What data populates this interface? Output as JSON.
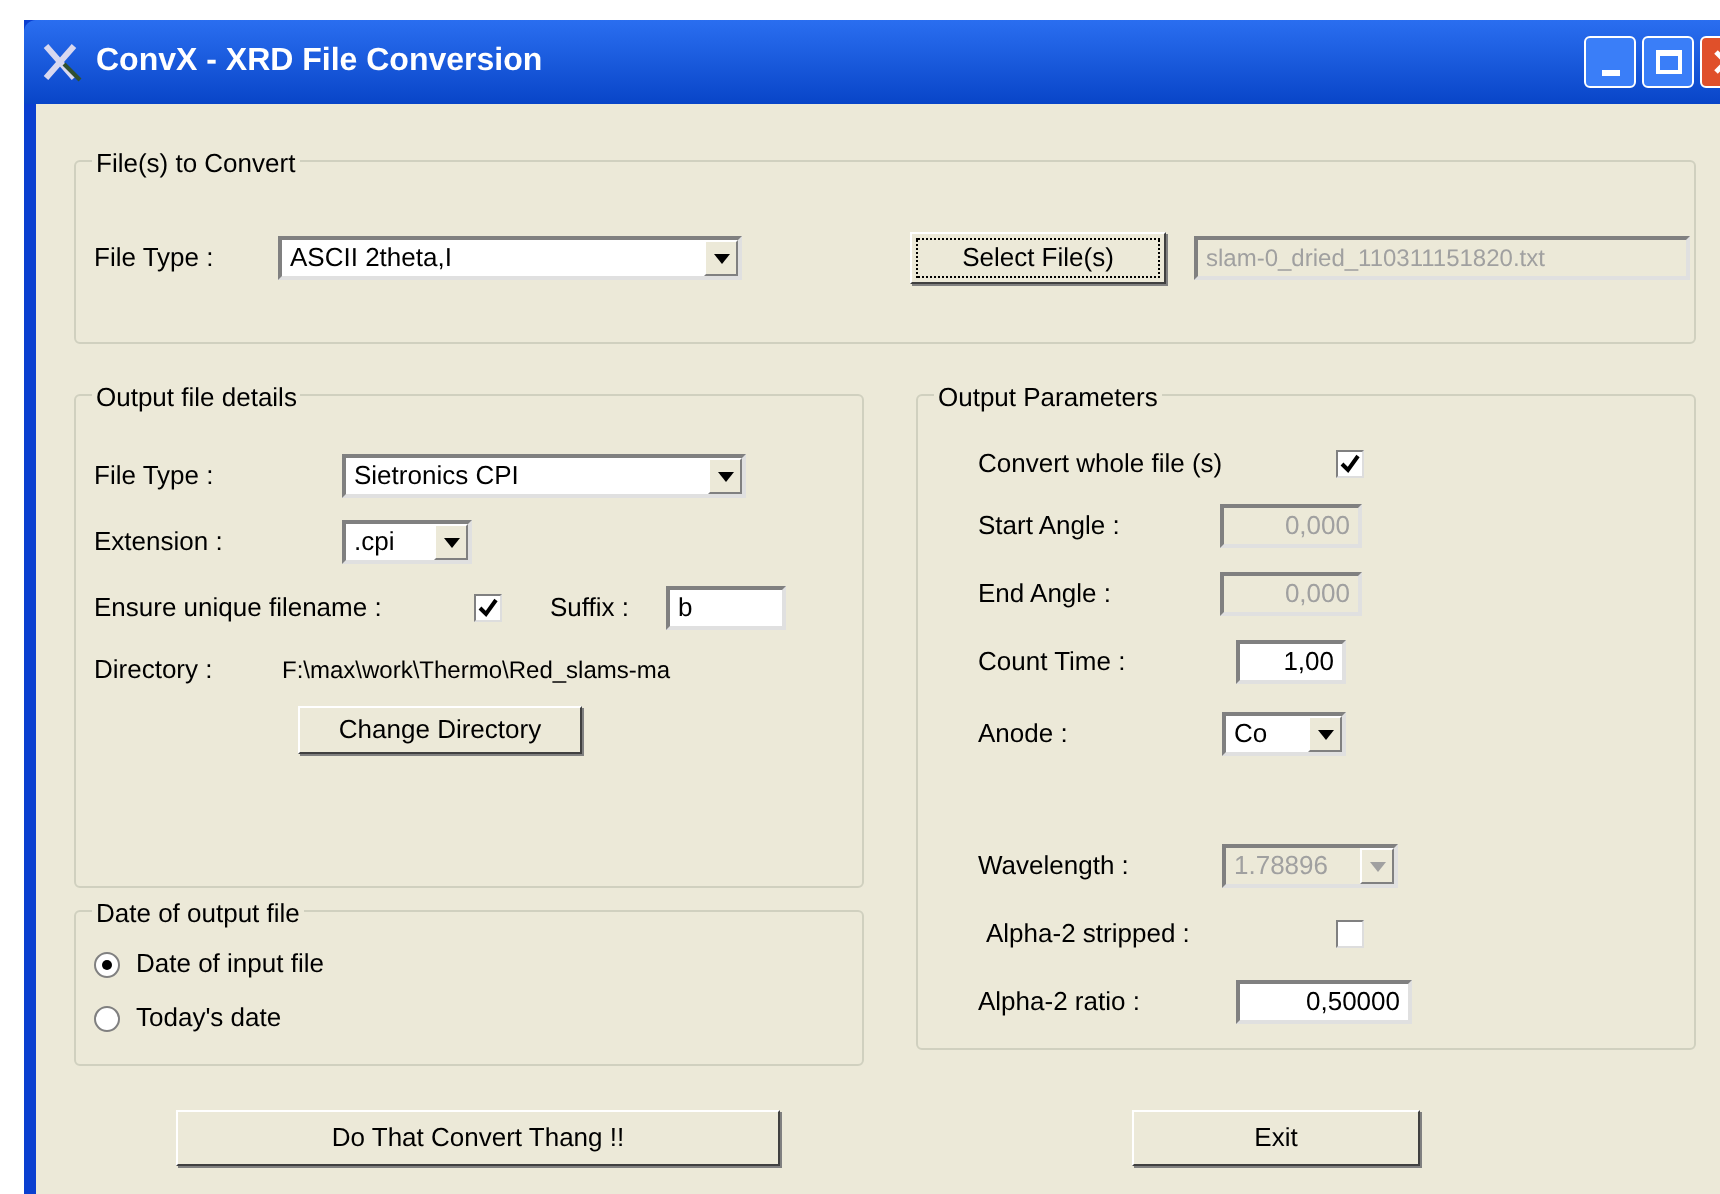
{
  "window": {
    "title": "ConvX - XRD File Conversion"
  },
  "files_to_convert": {
    "legend": "File(s) to Convert",
    "file_type": {
      "label": "File Type :",
      "value": "ASCII 2theta,I"
    },
    "select_button": "Select File(s)",
    "file_field": {
      "value": "slam-0_dried_110311151820.txt",
      "disabled": true
    }
  },
  "output_file_details": {
    "legend": "Output file details",
    "file_type": {
      "label": "File Type :",
      "value": "Sietronics CPI"
    },
    "extension": {
      "label": "Extension :",
      "value": ".cpi"
    },
    "ensure_unique": {
      "label": "Ensure unique filename :",
      "checked": true
    },
    "suffix": {
      "label": "Suffix :",
      "value": "b"
    },
    "directory": {
      "label": "Directory :",
      "value": "F:\\max\\work\\Thermo\\Red_slams-ma"
    },
    "change_button": "Change Directory"
  },
  "date_of_output_file": {
    "legend": "Date of output file",
    "options": [
      {
        "label": "Date of input file",
        "selected": true
      },
      {
        "label": "Today's date",
        "selected": false
      }
    ]
  },
  "output_parameters": {
    "legend": "Output Parameters",
    "rows": [
      {
        "kind": "checkbox",
        "label": "Convert whole file (s)",
        "checked": true
      },
      {
        "kind": "text",
        "label": "Start Angle :",
        "value": "0,000",
        "disabled": true
      },
      {
        "kind": "text",
        "label": "End Angle :",
        "value": "0,000",
        "disabled": true
      },
      {
        "kind": "text",
        "label": "Count  Time :",
        "value": "1,00",
        "disabled": false
      },
      {
        "kind": "select",
        "label": "Anode :",
        "value": "Co",
        "disabled": false
      },
      {
        "kind": "select",
        "label": "Wavelength :",
        "value": "1.78896",
        "disabled": true
      },
      {
        "kind": "checkbox",
        "label": "Alpha-2 stripped :",
        "checked": false
      },
      {
        "kind": "text",
        "label": "Alpha-2 ratio :",
        "value": "0,50000",
        "disabled": false
      }
    ]
  },
  "buttons": [
    "Do That Convert Thang !!",
    "Exit"
  ]
}
